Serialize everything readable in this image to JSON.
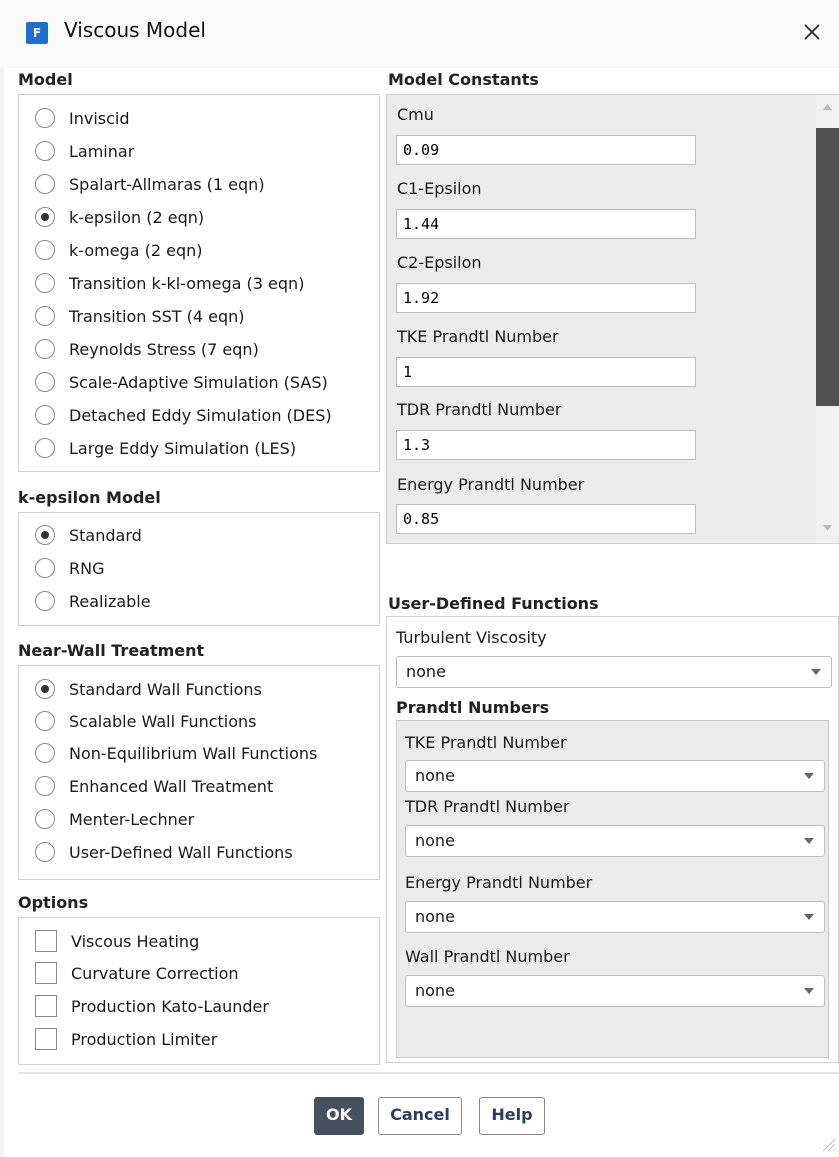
{
  "window": {
    "title": "Viscous Model",
    "app_icon": "F"
  },
  "model": {
    "title": "Model",
    "options": [
      {
        "label": "Inviscid",
        "selected": false
      },
      {
        "label": "Laminar",
        "selected": false
      },
      {
        "label": "Spalart-Allmaras (1 eqn)",
        "selected": false
      },
      {
        "label": "k-epsilon (2 eqn)",
        "selected": true
      },
      {
        "label": "k-omega (2 eqn)",
        "selected": false
      },
      {
        "label": "Transition k-kl-omega (3 eqn)",
        "selected": false
      },
      {
        "label": "Transition SST (4 eqn)",
        "selected": false
      },
      {
        "label": "Reynolds Stress (7 eqn)",
        "selected": false
      },
      {
        "label": "Scale-Adaptive Simulation (SAS)",
        "selected": false
      },
      {
        "label": "Detached Eddy Simulation (DES)",
        "selected": false
      },
      {
        "label": "Large Eddy Simulation (LES)",
        "selected": false
      }
    ]
  },
  "kepsilon": {
    "title": "k-epsilon Model",
    "options": [
      {
        "label": "Standard",
        "selected": true
      },
      {
        "label": "RNG",
        "selected": false
      },
      {
        "label": "Realizable",
        "selected": false
      }
    ]
  },
  "nearwall": {
    "title": "Near-Wall Treatment",
    "options": [
      {
        "label": "Standard Wall Functions",
        "selected": true
      },
      {
        "label": "Scalable Wall Functions",
        "selected": false
      },
      {
        "label": "Non-Equilibrium Wall Functions",
        "selected": false
      },
      {
        "label": "Enhanced Wall Treatment",
        "selected": false
      },
      {
        "label": "Menter-Lechner",
        "selected": false
      },
      {
        "label": "User-Defined Wall Functions",
        "selected": false
      }
    ]
  },
  "options": {
    "title": "Options",
    "items": [
      {
        "label": "Viscous Heating",
        "checked": false
      },
      {
        "label": "Curvature Correction",
        "checked": false
      },
      {
        "label": "Production Kato-Launder",
        "checked": false
      },
      {
        "label": "Production Limiter",
        "checked": false
      }
    ]
  },
  "constants": {
    "title": "Model Constants",
    "items": [
      {
        "label": "Cmu",
        "value": "0.09"
      },
      {
        "label": "C1-Epsilon",
        "value": "1.44"
      },
      {
        "label": "C2-Epsilon",
        "value": "1.92"
      },
      {
        "label": "TKE Prandtl Number",
        "value": "1"
      },
      {
        "label": "TDR Prandtl Number",
        "value": "1.3"
      },
      {
        "label": "Energy Prandtl Number",
        "value": "0.85"
      }
    ]
  },
  "udf": {
    "title": "User-Defined Functions",
    "turbulent_viscosity": {
      "label": "Turbulent Viscosity",
      "value": "none"
    },
    "prandtl_title": "Prandtl Numbers",
    "prandtl": [
      {
        "label": "TKE Prandtl Number",
        "value": "none"
      },
      {
        "label": "TDR Prandtl Number",
        "value": "none"
      },
      {
        "label": "Energy Prandtl Number",
        "value": "none"
      },
      {
        "label": "Wall Prandtl Number",
        "value": "none"
      }
    ]
  },
  "buttons": {
    "ok": "OK",
    "cancel": "Cancel",
    "help": "Help"
  },
  "colors": {
    "accent": "#1f6fd1",
    "primary_button": "#46505e",
    "panel": "#ebebeb"
  }
}
